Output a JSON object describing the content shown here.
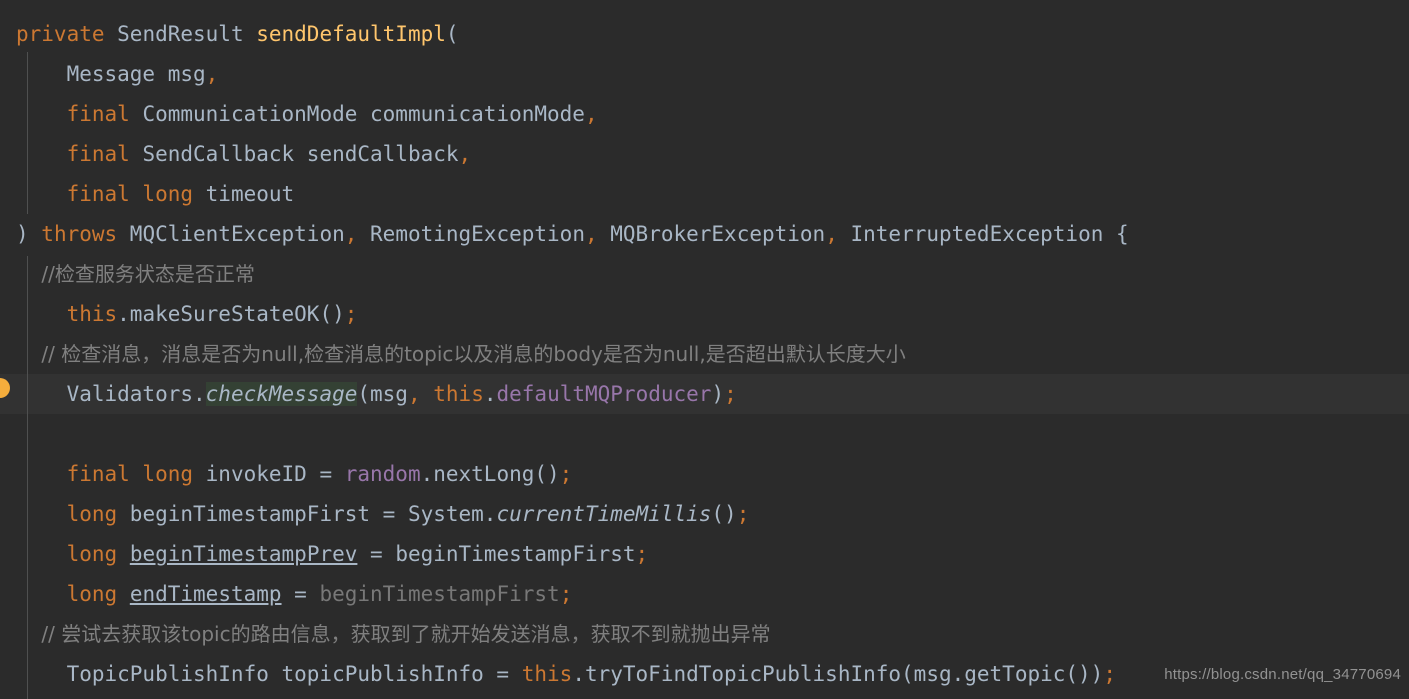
{
  "editor": {
    "background": "#2b2b2b",
    "current_line_background": "#323232",
    "breakpoint_color": "#f5ad3c",
    "highlight_color": "#344134",
    "colors": {
      "keyword": "#cc7832",
      "identifier": "#a9b7c6",
      "method": "#ffc66d",
      "field": "#9876aa",
      "comment": "#808080",
      "greyed_out": "#787878"
    }
  },
  "code": {
    "language": "java",
    "lines": [
      {
        "n": 1,
        "text": "private SendResult sendDefaultImpl(",
        "tokens": [
          {
            "t": "private",
            "c": "kw"
          },
          {
            "t": " SendResult ",
            "c": "id"
          },
          {
            "t": "sendDefaultImpl",
            "c": "mth"
          },
          {
            "t": "(",
            "c": "punc"
          }
        ]
      },
      {
        "n": 2,
        "text": "    Message msg,",
        "tokens": [
          {
            "t": "    Message msg",
            "c": "id"
          },
          {
            "t": ",",
            "c": "sep"
          }
        ]
      },
      {
        "n": 3,
        "text": "    final CommunicationMode communicationMode,",
        "tokens": [
          {
            "t": "    ",
            "c": "id"
          },
          {
            "t": "final",
            "c": "kw"
          },
          {
            "t": " CommunicationMode communicationMode",
            "c": "id"
          },
          {
            "t": ",",
            "c": "sep"
          }
        ]
      },
      {
        "n": 4,
        "text": "    final SendCallback sendCallback,",
        "tokens": [
          {
            "t": "    ",
            "c": "id"
          },
          {
            "t": "final",
            "c": "kw"
          },
          {
            "t": " SendCallback sendCallback",
            "c": "id"
          },
          {
            "t": ",",
            "c": "sep"
          }
        ]
      },
      {
        "n": 5,
        "text": "    final long timeout",
        "tokens": [
          {
            "t": "    ",
            "c": "id"
          },
          {
            "t": "final long",
            "c": "kw"
          },
          {
            "t": " timeout",
            "c": "id"
          }
        ]
      },
      {
        "n": 6,
        "text": ") throws MQClientException, RemotingException, MQBrokerException, InterruptedException {",
        "tokens": [
          {
            "t": ") ",
            "c": "punc"
          },
          {
            "t": "throws",
            "c": "kw"
          },
          {
            "t": " MQClientException",
            "c": "id"
          },
          {
            "t": ",",
            "c": "sep"
          },
          {
            "t": " RemotingException",
            "c": "id"
          },
          {
            "t": ",",
            "c": "sep"
          },
          {
            "t": " MQBrokerException",
            "c": "id"
          },
          {
            "t": ",",
            "c": "sep"
          },
          {
            "t": " InterruptedException {",
            "c": "id"
          }
        ]
      },
      {
        "n": 7,
        "text": "    //检查服务状态是否正常",
        "tokens": [
          {
            "t": "    //检查服务状态是否正常",
            "c": "cmt"
          }
        ]
      },
      {
        "n": 8,
        "text": "    this.makeSureStateOK();",
        "tokens": [
          {
            "t": "    ",
            "c": "id"
          },
          {
            "t": "this",
            "c": "kw"
          },
          {
            "t": ".makeSureStateOK()",
            "c": "id"
          },
          {
            "t": ";",
            "c": "sep"
          }
        ]
      },
      {
        "n": 9,
        "text": "    // 检查消息，消息是否为null,检查消息的topic以及消息的body是否为null,是否超出默认长度大小",
        "tokens": [
          {
            "t": "    // 检查消息，消息是否为null,检查消息的topic以及消息的body是否为null,是否超出默认长度大小",
            "c": "cmt"
          }
        ]
      },
      {
        "n": 10,
        "text": "    Validators.checkMessage(msg, this.defaultMQProducer);",
        "current": true,
        "breakpoint": true,
        "tokens": [
          {
            "t": "    Validators.",
            "c": "id"
          },
          {
            "t": "checkMessage",
            "c": "id ital hl"
          },
          {
            "t": "(msg",
            "c": "id"
          },
          {
            "t": ",",
            "c": "sep"
          },
          {
            "t": " ",
            "c": "id"
          },
          {
            "t": "this",
            "c": "kw"
          },
          {
            "t": ".",
            "c": "id"
          },
          {
            "t": "defaultMQProducer",
            "c": "fld"
          },
          {
            "t": ")",
            "c": "id"
          },
          {
            "t": ";",
            "c": "sep"
          }
        ]
      },
      {
        "n": 11,
        "text": "",
        "tokens": []
      },
      {
        "n": 12,
        "text": "    final long invokeID = random.nextLong();",
        "tokens": [
          {
            "t": "    ",
            "c": "id"
          },
          {
            "t": "final long",
            "c": "kw"
          },
          {
            "t": " invokeID = ",
            "c": "id"
          },
          {
            "t": "random",
            "c": "fld"
          },
          {
            "t": ".nextLong()",
            "c": "id"
          },
          {
            "t": ";",
            "c": "sep"
          }
        ]
      },
      {
        "n": 13,
        "text": "    long beginTimestampFirst = System.currentTimeMillis();",
        "tokens": [
          {
            "t": "    ",
            "c": "id"
          },
          {
            "t": "long",
            "c": "kw"
          },
          {
            "t": " beginTimestampFirst = System.",
            "c": "id"
          },
          {
            "t": "currentTimeMillis",
            "c": "id ital"
          },
          {
            "t": "()",
            "c": "id"
          },
          {
            "t": ";",
            "c": "sep"
          }
        ]
      },
      {
        "n": 14,
        "text": "    long beginTimestampPrev = beginTimestampFirst;",
        "tokens": [
          {
            "t": "    ",
            "c": "id"
          },
          {
            "t": "long",
            "c": "kw"
          },
          {
            "t": " ",
            "c": "id"
          },
          {
            "t": "beginTimestampPrev",
            "c": "id und"
          },
          {
            "t": " = beginTimestampFirst",
            "c": "id"
          },
          {
            "t": ";",
            "c": "sep"
          }
        ]
      },
      {
        "n": 15,
        "text": "    long endTimestamp = beginTimestampFirst;",
        "tokens": [
          {
            "t": "    ",
            "c": "id"
          },
          {
            "t": "long",
            "c": "kw"
          },
          {
            "t": " ",
            "c": "id"
          },
          {
            "t": "endTimestamp",
            "c": "id und"
          },
          {
            "t": " = ",
            "c": "id"
          },
          {
            "t": "beginTimestampFirst",
            "c": "grey"
          },
          {
            "t": ";",
            "c": "sep"
          }
        ]
      },
      {
        "n": 16,
        "text": "    // 尝试去获取该topic的路由信息，获取到了就开始发送消息，获取不到就抛出异常",
        "tokens": [
          {
            "t": "    // 尝试去获取该topic的路由信息，获取到了就开始发送消息，获取不到就抛出异常",
            "c": "cmt"
          }
        ]
      },
      {
        "n": 17,
        "text": "    TopicPublishInfo topicPublishInfo = this.tryToFindTopicPublishInfo(msg.getTopic());",
        "tokens": [
          {
            "t": "    TopicPublishInfo topicPublishInfo = ",
            "c": "id"
          },
          {
            "t": "this",
            "c": "kw"
          },
          {
            "t": ".tryToFindTopicPublishInfo(msg.getTopic())",
            "c": "id"
          },
          {
            "t": ";",
            "c": "sep"
          }
        ]
      }
    ]
  },
  "watermark": {
    "text": "https://blog.csdn.net/qq_34770694"
  }
}
